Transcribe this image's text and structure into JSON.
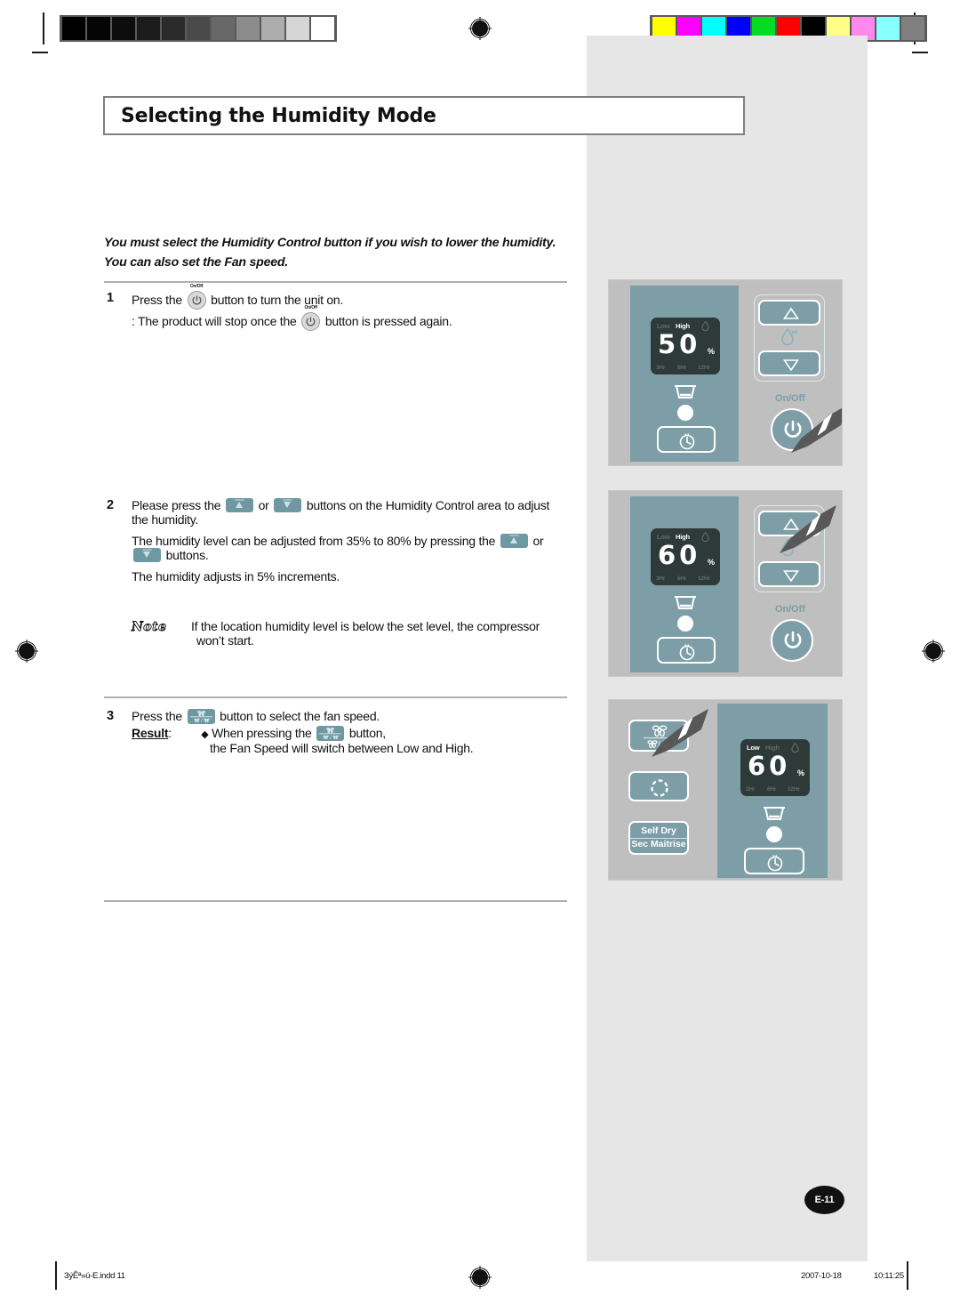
{
  "document": {
    "title": "Selecting the Humidity Mode",
    "page_badge": "E-11"
  },
  "intro": {
    "line1": "You must select the Humidity Control button if you wish to lower the humidity.",
    "line2": "You can also set the Fan speed."
  },
  "steps": [
    {
      "number": "1",
      "line1_a": "Press the",
      "line1_b": "button to turn the unit on.",
      "line2_a": ": The product will stop once the",
      "line2_b": "button is pressed again."
    },
    {
      "number": "2",
      "line1_a": "Please press the",
      "line1_or": "or",
      "line1_b": "buttons on the Humidity Control area to adjust",
      "line2": "the humidity.",
      "line3_a": "The humidity level can be adjusted from 35% to 80% by pressing the",
      "line3_or": "or",
      "line4_b": "buttons.",
      "line5": "The humidity adjusts in 5% increments."
    },
    {
      "number": "3",
      "line1_a": "Press the",
      "line1_b": "button to select the fan speed.",
      "result_label": "Result",
      "result_colon": ":",
      "bullet": "◆",
      "result_a": "When pressing the",
      "result_b": "button,",
      "result_line2": "the Fan Speed will switch between Low and High."
    }
  ],
  "note": {
    "badge": "Note",
    "line1": "If the location humidity level is below the set level, the compressor",
    "line2": "won’t start."
  },
  "panels": [
    {
      "name": "panel-power-on",
      "lcd": {
        "label_low": "Low",
        "label_high": "High",
        "value": "50",
        "percent": "%",
        "timer_3": "3Hr",
        "timer_6": "6Hr",
        "timer_12": "12Hr",
        "active_speed": "High"
      },
      "onoff_label": "On/Off",
      "pointer_target": "power-button"
    },
    {
      "name": "panel-humidity-up",
      "lcd": {
        "label_low": "Low",
        "label_high": "High",
        "value": "60",
        "percent": "%",
        "timer_3": "3Hr",
        "timer_6": "6Hr",
        "timer_12": "12Hr",
        "active_speed": "High"
      },
      "onoff_label": "On/Off",
      "pointer_target": "humidity-up-button"
    },
    {
      "name": "panel-fan-speed",
      "lcd": {
        "label_low": "Low",
        "label_high": "High",
        "value": "60",
        "percent": "%",
        "timer_3": "3Hr",
        "timer_6": "6Hr",
        "timer_12": "12Hr",
        "active_speed": "Low"
      },
      "self_dry_line1": "Self Dry",
      "self_dry_line2": "Sec Maitrise",
      "pointer_target": "fan-speed-button"
    }
  ],
  "calibration": {
    "grayscale": [
      "#000000",
      "#050505",
      "#0d0d0d",
      "#1b1b1b",
      "#2b2b2b",
      "#4a4a4a",
      "#686868",
      "#8c8c8c",
      "#adadad",
      "#d6d6d6",
      "#ffffff"
    ],
    "colors": [
      "#ffff00",
      "#ff00ff",
      "#00ffff",
      "#0000ff",
      "#00dd22",
      "#ff0000",
      "#000000",
      "#ffff88",
      "#ff88ee",
      "#88ffff",
      "#808080"
    ]
  },
  "footer": {
    "filename": "ЗýÊª»ú-E.indd   11",
    "date": "2007-10-18",
    "time": "10:11:25"
  }
}
